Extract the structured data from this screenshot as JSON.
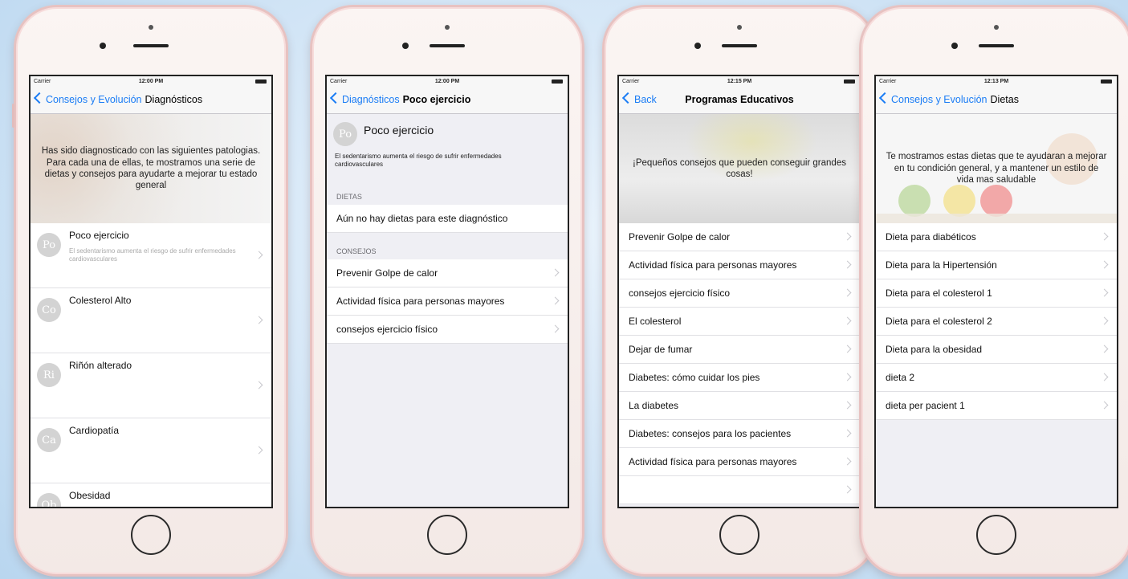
{
  "screens": [
    {
      "status": {
        "carrier": "Carrier",
        "time": "12:00 PM"
      },
      "nav": {
        "back": "Consejos y Evolución",
        "title": "Diagnósticos"
      },
      "hero": {
        "text": "Has sido diagnosticado con las siguientes patologias.  Para cada una de ellas, te mostramos una serie de dietas y consejos para ayudarte a mejorar tu estado general"
      },
      "items": [
        {
          "initials": "Po",
          "title": "Poco ejercicio",
          "desc": "El sedentarismo aumenta el riesgo de sufrir enfermedades cardiovasculares"
        },
        {
          "initials": "Co",
          "title": "Colesterol Alto",
          "desc": ""
        },
        {
          "initials": "Ri",
          "title": "Riñón alterado",
          "desc": ""
        },
        {
          "initials": "Ca",
          "title": "Cardiopatía",
          "desc": ""
        },
        {
          "initials": "Ob",
          "title": "Obesidad",
          "desc": ""
        }
      ]
    },
    {
      "status": {
        "carrier": "Carrier",
        "time": "12:00 PM"
      },
      "nav": {
        "back": "Diagnósticos",
        "title": "Poco ejercicio"
      },
      "header": {
        "initials": "Po",
        "title": "Poco ejercicio",
        "desc": "El sedentarismo aumenta el riesgo de sufrir enfermedades cardiovasculares"
      },
      "dietas": {
        "label": "DIETAS",
        "items": [
          "Aún no hay dietas para este diagnóstico"
        ]
      },
      "consejos": {
        "label": "CONSEJOS",
        "items": [
          "Prevenir Golpe de calor",
          "Actividad física para personas mayores",
          "consejos ejercicio físico"
        ]
      }
    },
    {
      "status": {
        "carrier": "Carrier",
        "time": "12:15 PM"
      },
      "nav": {
        "back": "Back",
        "title": "Programas Educativos"
      },
      "hero": {
        "text": "¡Pequeños consejos que pueden conseguir grandes cosas!"
      },
      "items": [
        "Prevenir Golpe de calor",
        "Actividad física para personas mayores",
        "consejos ejercicio físico",
        "El colesterol",
        "Dejar de fumar",
        "Diabetes: cómo cuidar los pies",
        "La diabetes",
        "Diabetes: consejos para los pacientes",
        "Actividad física para personas mayores",
        ""
      ]
    },
    {
      "status": {
        "carrier": "Carrier",
        "time": "12:13 PM"
      },
      "nav": {
        "back": "Consejos y Evolución",
        "title": "Dietas"
      },
      "hero": {
        "text": "Te mostramos estas dietas que te ayudaran a mejorar en tu condición general, y a mantener un estilo de vida mas saludable"
      },
      "items": [
        "Dieta para diabéticos",
        "Dieta para la Hipertensión",
        "Dieta para el colesterol 1",
        "Dieta para el colesterol 2",
        "Dieta para la obesidad",
        "dieta 2",
        "dieta per pacient 1"
      ]
    }
  ],
  "colors": {
    "accent": "#1a7cf5",
    "phone_frame": "#e7c2c1"
  }
}
